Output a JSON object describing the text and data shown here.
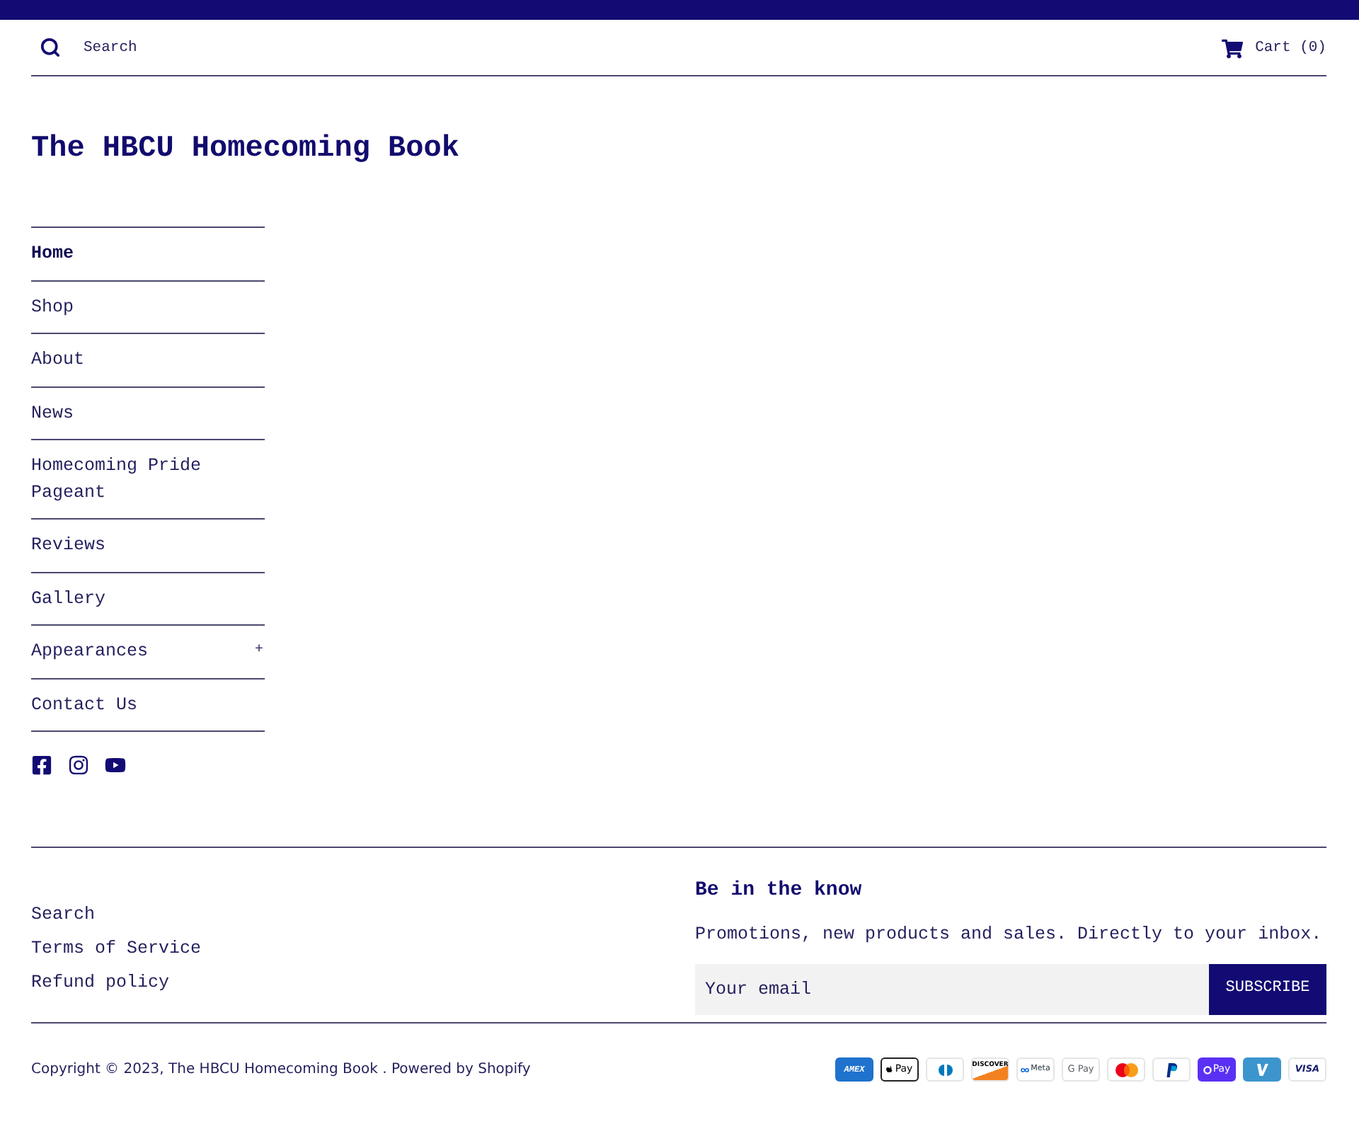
{
  "header": {
    "search": {
      "placeholder": "Search"
    },
    "cart": {
      "label": "Cart (0)"
    }
  },
  "site_title": "The HBCU Homecoming Book",
  "nav": {
    "items": [
      {
        "label": "Home",
        "selected": true
      },
      {
        "label": "Shop",
        "selected": false
      },
      {
        "label": "About",
        "selected": false
      },
      {
        "label": "News",
        "selected": false
      },
      {
        "label": "Homecoming Pride Pageant",
        "selected": false
      },
      {
        "label": "Reviews",
        "selected": false
      },
      {
        "label": "Gallery",
        "selected": false
      },
      {
        "label": "Appearances",
        "selected": false,
        "toggle": "+"
      },
      {
        "label": "Contact Us",
        "selected": false
      }
    ]
  },
  "social_links": [
    {
      "kind": "facebook"
    },
    {
      "kind": "instagram"
    },
    {
      "kind": "youtube"
    }
  ],
  "footer": {
    "links": [
      "Search",
      "Terms of Service",
      "Refund policy"
    ],
    "newsletter": {
      "title": "Be in the know",
      "text": "Promotions, new products and sales. Directly to your inbox.",
      "email": {
        "placeholder": "Your email"
      },
      "button": "SUBSCRIBE"
    },
    "copyright": {
      "prefix": "Copyright © 2023, ",
      "store_link": "The HBCU Homecoming Book",
      "separator": " . ",
      "powered": "Powered by Shopify"
    },
    "payment_methods": [
      {
        "kind": "amex",
        "label": "AMEX"
      },
      {
        "kind": "applepay",
        "label": "Pay"
      },
      {
        "kind": "diners"
      },
      {
        "kind": "discover",
        "label": "DISCOVER"
      },
      {
        "kind": "meta",
        "label": "Meta"
      },
      {
        "kind": "gpay",
        "label": "G Pay"
      },
      {
        "kind": "mastercard"
      },
      {
        "kind": "paypal"
      },
      {
        "kind": "shoppay",
        "label": "Pay"
      },
      {
        "kind": "venmo"
      },
      {
        "kind": "visa",
        "label": "VISA"
      }
    ]
  }
}
